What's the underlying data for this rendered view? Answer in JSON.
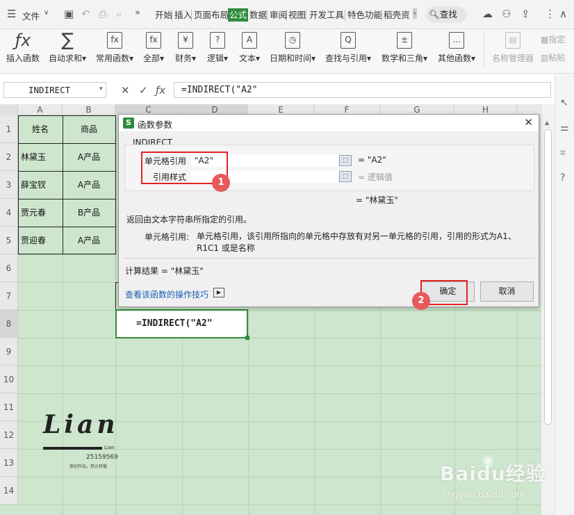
{
  "menu": {
    "file_label": "文件",
    "tabs": [
      "开始",
      "插入",
      "页面布局",
      "公式",
      "数据",
      "审阅",
      "视图",
      "开发工具",
      "特色功能",
      "稻壳资"
    ],
    "active_tab": "公式",
    "search_label": "查找"
  },
  "ribbon": {
    "buttons": [
      {
        "label": "插入函数",
        "icon": "fx"
      },
      {
        "label": "自动求和▾",
        "icon": "∑"
      },
      {
        "label": "常用函数▾",
        "icon": "fx"
      },
      {
        "label": "全部▾",
        "icon": "fx"
      },
      {
        "label": "财务▾",
        "icon": "¥"
      },
      {
        "label": "逻辑▾",
        "icon": "?"
      },
      {
        "label": "文本▾",
        "icon": "A"
      },
      {
        "label": "日期和时间▾",
        "icon": "◷"
      },
      {
        "label": "查找与引用▾",
        "icon": "Q"
      },
      {
        "label": "数学和三角▾",
        "icon": "±"
      },
      {
        "label": "其他函数▾",
        "icon": "…"
      }
    ],
    "name_manager": "名称管理器",
    "specify": "指定",
    "paste": "粘贴"
  },
  "formula_bar": {
    "name_box": "INDIRECT",
    "formula": "=INDIRECT(\"A2\""
  },
  "grid": {
    "columns": [
      "A",
      "B",
      "C",
      "D",
      "E",
      "F",
      "G",
      "H"
    ],
    "rows": [
      "1",
      "2",
      "3",
      "4",
      "5",
      "6",
      "7",
      "8",
      "9",
      "10",
      "11",
      "12",
      "13",
      "14"
    ],
    "header_row": [
      "姓名",
      "商品"
    ],
    "data": [
      [
        "林黛玉",
        "A产品"
      ],
      [
        "薛宝钗",
        "A产品"
      ],
      [
        "贾元春",
        "B产品"
      ],
      [
        "贾迎春",
        "A产品"
      ]
    ],
    "active_cell_text": "=INDIRECT(\"A2\""
  },
  "dialog": {
    "title": "函数参数",
    "function_name": "INDIRECT",
    "arg1_label": "单元格引用",
    "arg1_value": "\"A2\"",
    "arg1_result": "= \"A2\"",
    "arg2_label": "引用样式",
    "arg2_value": "",
    "arg2_result": "= 逻辑值",
    "function_result": "= \"林黛玉\"",
    "description": "返回由文本字符串所指定的引用。",
    "arg_desc_label": "单元格引用:",
    "arg_desc_text": "单元格引用，该引用所指向的单元格中存放有对另一单元格的引用，引用的形式为A1、R1C1 或是名称",
    "calc_result": "计算结果 = \"林黛玉\"",
    "tips_link": "查看该函数的操作技巧",
    "ok_label": "确定",
    "cancel_label": "取消"
  },
  "annotations": {
    "badge1": "1",
    "badge2": "2"
  },
  "watermark": {
    "logo": "Lian",
    "logo_sub": "Lian",
    "number": "25159569",
    "note": "原创作品，禁止转载",
    "site": "Baidu经验",
    "url": "jingyan.baidu.com"
  },
  "colors": {
    "accent": "#2e8b3c",
    "grid_fill": "#cde6cd",
    "annotation_red": "#e02222"
  }
}
